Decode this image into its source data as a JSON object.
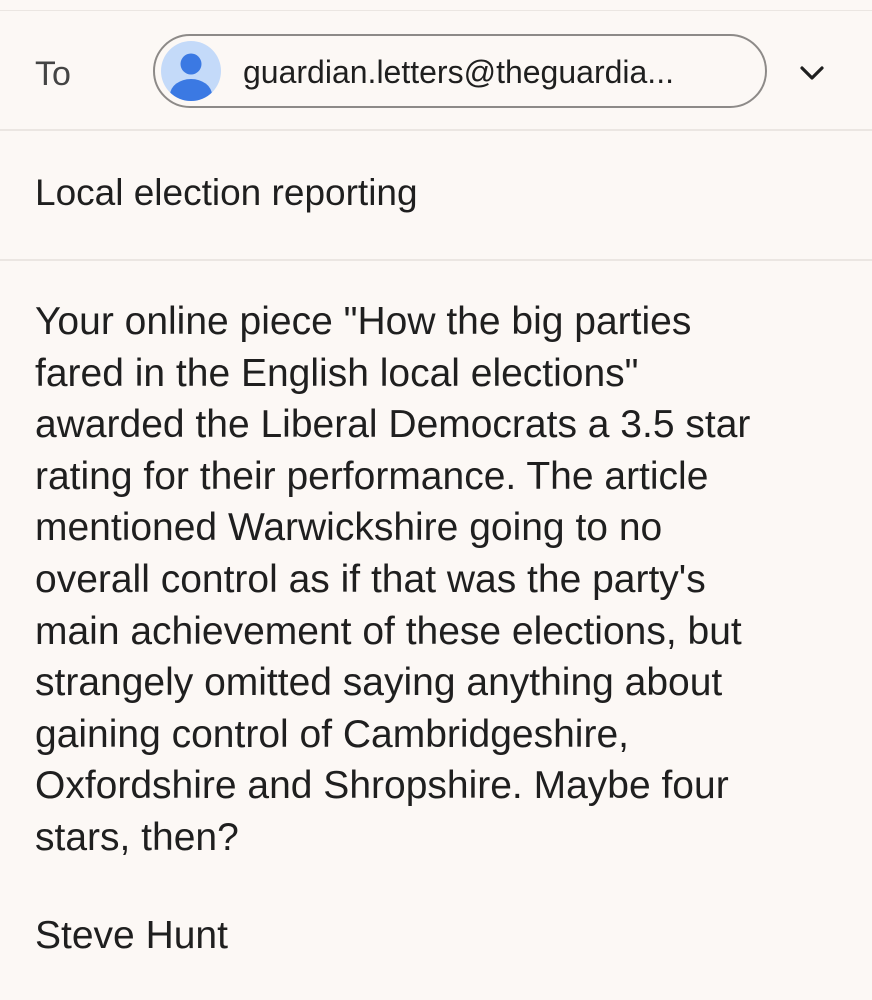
{
  "compose": {
    "to_label": "To",
    "recipient": "guardian.letters@theguardia...",
    "subject": "Local election reporting",
    "body_lines": [
      "Your online piece \"How the big parties",
      "fared in the English local elections\"",
      "awarded the Liberal Democrats a 3.5 star",
      "rating for their performance. The article",
      "mentioned Warwickshire going to no",
      "overall control as if that was the party's",
      "main achievement of these elections, but",
      "strangely omitted saying anything about",
      "gaining control of Cambridgeshire,",
      "Oxfordshire and Shropshire. Maybe four",
      "stars, then?"
    ],
    "signature": "Steve Hunt"
  },
  "icons": {
    "avatar": "person-avatar-icon",
    "expand": "chevron-down-icon"
  },
  "colors": {
    "background": "#fcf8f5",
    "avatar_bg": "#c4daf9",
    "avatar_fg": "#3b79e3",
    "text": "#1f1f1f"
  }
}
